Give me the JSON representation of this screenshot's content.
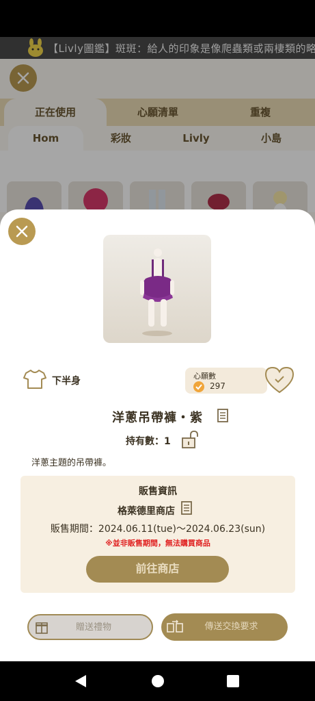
{
  "marquee": {
    "text": "【Livly圖鑑】斑斑：給人的印象是像爬蟲類或兩棲類的略小型"
  },
  "background": {
    "tabs_top": [
      "正在使用",
      "心願清單",
      "重複"
    ],
    "tabs_sub": [
      "Hom",
      "彩妝",
      "Livly",
      "小島"
    ]
  },
  "modal": {
    "category": "下半身",
    "wishlist": {
      "title": "心願數",
      "count": "297"
    },
    "item_name": "洋蔥吊帶褲・紫",
    "owned": "持有數：1",
    "description": "洋蔥主題的吊帶褲。",
    "sale": {
      "title": "販售資訊",
      "shop": "格萊德里商店",
      "period": "販售期間：2024.06.11(tue)～2024.06.23(sun)",
      "warning": "※並非販售期間，無法購買商品",
      "go_shop": "前往商店"
    },
    "buttons": {
      "gift": "贈送禮物",
      "trade": "傳送交換要求"
    }
  },
  "colors": {
    "accent": "#a38b53",
    "close": "#b99a52",
    "warning": "#e02020",
    "sale_bg": "#f7efe1"
  },
  "icons": [
    "close-icon",
    "shirt-icon",
    "document-icon",
    "unlock-icon",
    "heart-check-icon",
    "gift-icon",
    "trade-icon",
    "back-icon",
    "home-icon",
    "recents-icon"
  ]
}
